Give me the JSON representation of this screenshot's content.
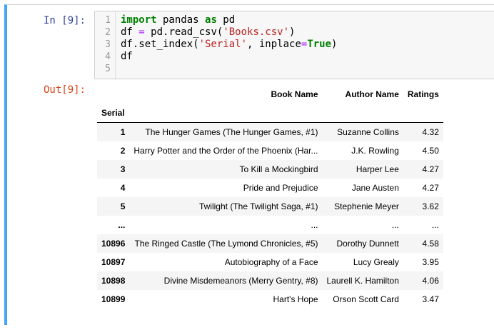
{
  "input_prompt": "In [9]:",
  "output_prompt": "Out[9]:",
  "code": {
    "line_numbers": [
      "1",
      "2",
      "3",
      "4",
      "5"
    ],
    "l1_kw_import": "import",
    "l1_mid": " pandas ",
    "l1_kw_as": "as",
    "l1_end": " pd",
    "l2_start": "df ",
    "l2_op": "=",
    "l2_mid": " pd.read_csv(",
    "l2_str": "'Books.csv'",
    "l2_end": ")",
    "l3_start": "df.set_index(",
    "l3_str": "'Serial'",
    "l3_mid": ", inplace",
    "l3_op": "=",
    "l3_true": "True",
    "l3_end": ")",
    "l4": "df",
    "l5": ""
  },
  "table": {
    "columns": [
      "Book Name",
      "Author Name",
      "Ratings"
    ],
    "index_name": "Serial",
    "rows": [
      {
        "idx": "1",
        "book": "The Hunger Games (The Hunger Games, #1)",
        "author": "Suzanne Collins",
        "rating": "4.32"
      },
      {
        "idx": "2",
        "book": "Harry Potter and the Order of the Phoenix (Har...",
        "author": "J.K. Rowling",
        "rating": "4.50"
      },
      {
        "idx": "3",
        "book": "To Kill a Mockingbird",
        "author": "Harper Lee",
        "rating": "4.27"
      },
      {
        "idx": "4",
        "book": "Pride and Prejudice",
        "author": "Jane Austen",
        "rating": "4.27"
      },
      {
        "idx": "5",
        "book": "Twilight (The Twilight Saga, #1)",
        "author": "Stephenie Meyer",
        "rating": "3.62"
      },
      {
        "idx": "...",
        "book": "...",
        "author": "...",
        "rating": "..."
      },
      {
        "idx": "10896",
        "book": "The Ringed Castle (The Lymond Chronicles, #5)",
        "author": "Dorothy Dunnett",
        "rating": "4.58"
      },
      {
        "idx": "10897",
        "book": "Autobiography of a Face",
        "author": "Lucy Grealy",
        "rating": "3.95"
      },
      {
        "idx": "10898",
        "book": "Divine Misdemeanors (Merry Gentry, #8)",
        "author": "Laurell K. Hamilton",
        "rating": "4.06"
      },
      {
        "idx": "10899",
        "book": "Hart's Hope",
        "author": "Orson Scott Card",
        "rating": "3.47"
      }
    ]
  }
}
